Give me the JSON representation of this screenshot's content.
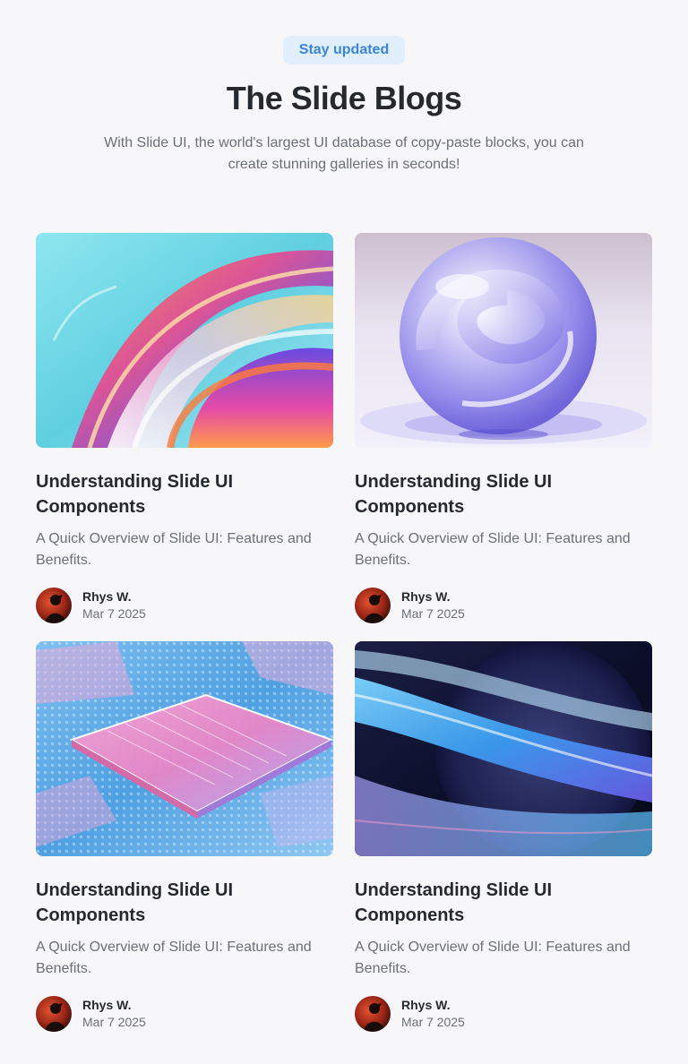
{
  "header": {
    "badge": "Stay updated",
    "title": "The Slide Blogs",
    "subtitle": "With Slide UI, the world's largest UI database of copy-paste blocks, you can create stunning galleries in seconds!"
  },
  "posts": [
    {
      "image": "abstract-glass-swirl-image",
      "title": "Understanding Slide UI Components",
      "description": "A Quick Overview of Slide UI: Features and Benefits.",
      "author": "Rhys W.",
      "date": "Mar 7 2025"
    },
    {
      "image": "glass-sphere-image",
      "title": "Understanding Slide UI Components",
      "description": "A Quick Overview of Slide UI: Features and Benefits.",
      "author": "Rhys W.",
      "date": "Mar 7 2025"
    },
    {
      "image": "circuit-chip-image",
      "title": "Understanding Slide UI Components",
      "description": "A Quick Overview of Slide UI: Features and Benefits.",
      "author": "Rhys W.",
      "date": "Mar 7 2025"
    },
    {
      "image": "blue-ribbon-wave-image",
      "title": "Understanding Slide UI Components",
      "description": "A Quick Overview of Slide UI: Features and Benefits.",
      "author": "Rhys W.",
      "date": "Mar 7 2025"
    }
  ],
  "colors": {
    "background": "#f7f7f9",
    "badge_bg": "#e1eefb",
    "badge_text": "#3b86d8",
    "heading": "#26292e",
    "muted": "#6b6f76"
  }
}
